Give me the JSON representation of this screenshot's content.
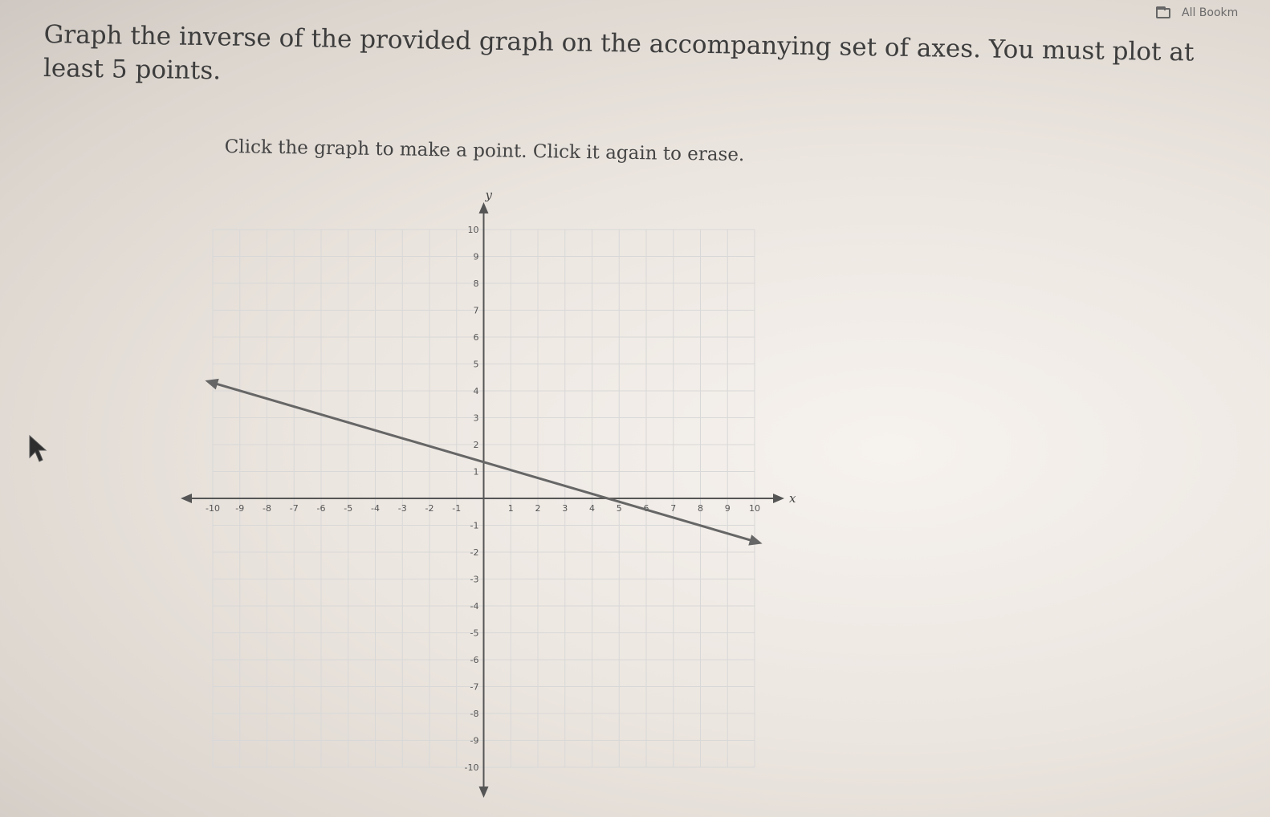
{
  "header": {
    "bookmark_label": "All Bookm"
  },
  "question": {
    "text": "Graph the inverse of the provided graph on the accompanying set of axes. You must plot at least 5 points."
  },
  "instruction": {
    "text": "Click the graph to make a point. Click it again to erase."
  },
  "chart_data": {
    "type": "line",
    "xlabel": "x",
    "ylabel": "y",
    "xlim": [
      -10,
      10
    ],
    "ylim": [
      -10,
      10
    ],
    "x_ticks": [
      "-10",
      "-9",
      "-8",
      "-7",
      "-6",
      "-5",
      "-4",
      "-3",
      "-2",
      "-1",
      "1",
      "2",
      "3",
      "4",
      "5",
      "6",
      "7",
      "8",
      "9",
      "10"
    ],
    "y_ticks": [
      "10",
      "9",
      "8",
      "7",
      "6",
      "5",
      "4",
      "3",
      "2",
      "1",
      "-1",
      "-2",
      "-3",
      "-4",
      "-5",
      "-6",
      "-7",
      "-8",
      "-9",
      "-10"
    ],
    "grid": true,
    "series": [
      {
        "x": [
          -10,
          10
        ],
        "y": [
          4.3,
          -1.6
        ]
      }
    ]
  },
  "colors": {
    "line": "#666666",
    "grid": "#d8d8d8",
    "axis": "#555555"
  },
  "icons": {
    "cursor": "mouse-pointer-icon",
    "folder": "folder-icon"
  }
}
